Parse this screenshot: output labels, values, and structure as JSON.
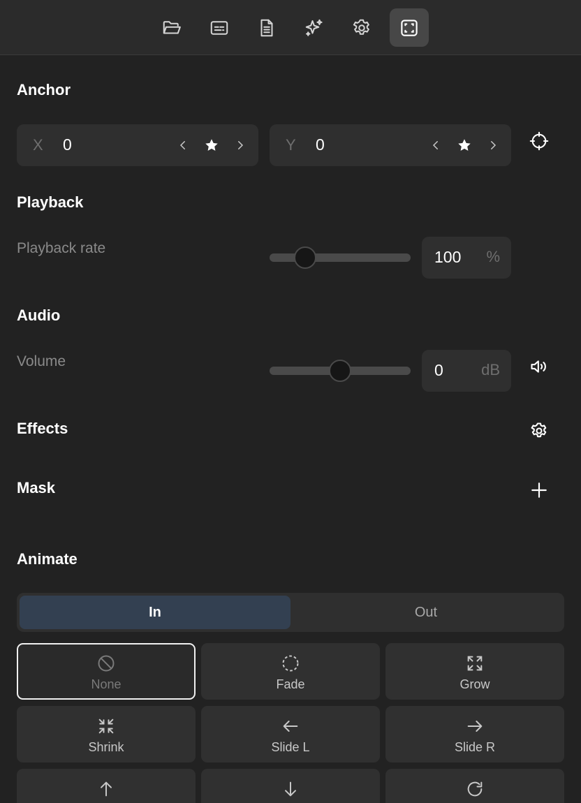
{
  "toolbar": {
    "tabs": [
      {
        "name": "folder-icon",
        "active": false
      },
      {
        "name": "subtitles-icon",
        "active": false
      },
      {
        "name": "document-icon",
        "active": false
      },
      {
        "name": "sparkles-icon",
        "active": false
      },
      {
        "name": "gear-icon",
        "active": false
      },
      {
        "name": "frame-icon",
        "active": true
      }
    ]
  },
  "anchor": {
    "title": "Anchor",
    "x": {
      "axis": "X",
      "value": "0"
    },
    "y": {
      "axis": "Y",
      "value": "0"
    },
    "target_icon": "crosshair-icon"
  },
  "playback": {
    "title": "Playback",
    "rate_label": "Playback rate",
    "rate_value": "100",
    "rate_unit": "%",
    "slider_fraction": 0.25
  },
  "audio": {
    "title": "Audio",
    "volume_label": "Volume",
    "volume_value": "0",
    "volume_unit": "dB",
    "slider_fraction": 0.5,
    "speaker_icon": "volume-icon"
  },
  "effects": {
    "title": "Effects",
    "icon": "gear-icon"
  },
  "mask": {
    "title": "Mask",
    "icon": "plus-icon"
  },
  "animate": {
    "title": "Animate",
    "tabs": [
      {
        "label": "In",
        "active": true
      },
      {
        "label": "Out",
        "active": false
      }
    ],
    "options": [
      {
        "label": "None",
        "icon": "ban-icon",
        "selected": true
      },
      {
        "label": "Fade",
        "icon": "dashed-circle-icon",
        "selected": false
      },
      {
        "label": "Grow",
        "icon": "expand-icon",
        "selected": false
      },
      {
        "label": "Shrink",
        "icon": "shrink-icon",
        "selected": false
      },
      {
        "label": "Slide L",
        "icon": "arrow-left-icon",
        "selected": false
      },
      {
        "label": "Slide R",
        "icon": "arrow-right-icon",
        "selected": false
      },
      {
        "label": "",
        "icon": "arrow-up-icon",
        "selected": false
      },
      {
        "label": "",
        "icon": "arrow-down-icon",
        "selected": false
      },
      {
        "label": "",
        "icon": "rotate-icon",
        "selected": false
      }
    ]
  },
  "colors": {
    "background": "#222222",
    "active_tab": "#334051",
    "field_bg": "#2f2f2f"
  }
}
